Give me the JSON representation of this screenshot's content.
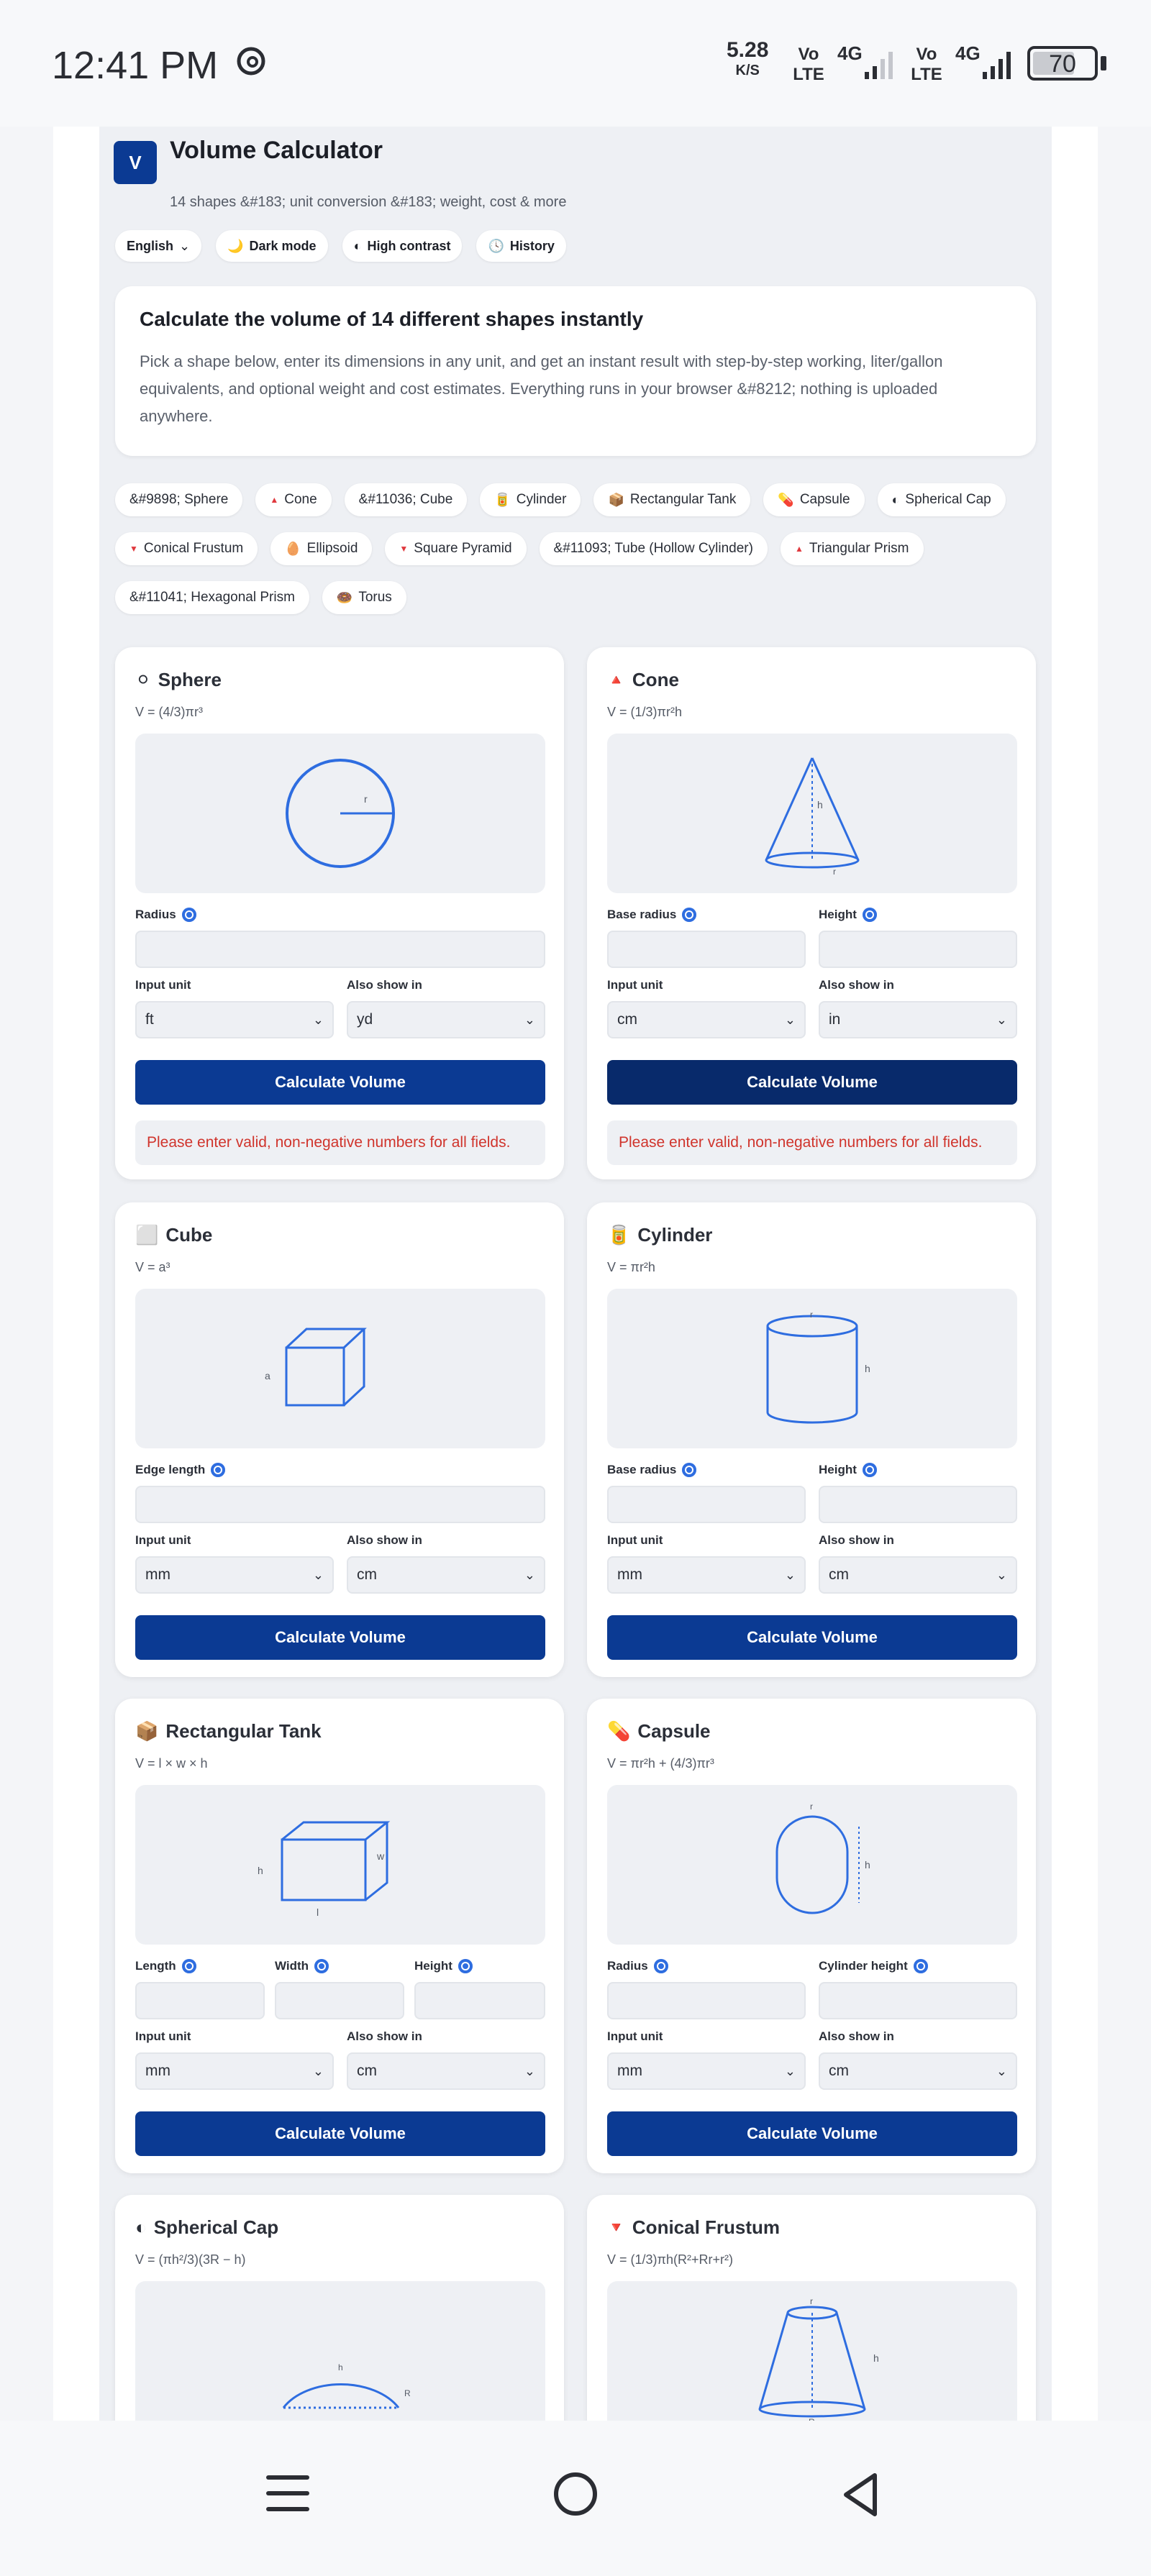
{
  "status_bar": {
    "time": "12:41 PM",
    "net_speed_value": "5.28",
    "net_speed_unit": "K/S",
    "sim1_label": "Vo LTE",
    "sim1_net": "4G",
    "sim2_label": "Vo LTE",
    "sim2_net": "4G",
    "battery": "70",
    "battery_level": 0.7,
    "threads_icon": "threads-icon"
  },
  "header": {
    "logo_letter": "V",
    "title": "Volume Calculator",
    "subtitle": "14 shapes &#183; unit conversion &#183; weight, cost & more",
    "chips": [
      {
        "icon": "",
        "label": "English",
        "has_caret": true
      },
      {
        "icon": "🌙",
        "label": "Dark mode"
      },
      {
        "icon": "◐",
        "label": "High contrast"
      },
      {
        "icon": "🕓",
        "label": "History"
      }
    ]
  },
  "intro": {
    "heading": "Calculate the volume of 14 different shapes instantly",
    "body": "Pick a shape below, enter its dimensions in any unit, and get an instant result with step-by-step working, liter/gallon equivalents, and optional weight and cost estimates. Everything runs in your browser &#8212; nothing is uploaded anywhere."
  },
  "shape_chips": [
    {
      "icon": "",
      "label": "&#9898; Sphere"
    },
    {
      "icon": "▲",
      "label": "Cone"
    },
    {
      "icon": "",
      "label": "&#11036; Cube"
    },
    {
      "icon": "🥫",
      "label": "Cylinder"
    },
    {
      "icon": "📦",
      "label": "Rectangular Tank"
    },
    {
      "icon": "💊",
      "label": "Capsule"
    },
    {
      "icon": "◐",
      "label": "Spherical Cap"
    },
    {
      "icon": "▼",
      "label": "Conical Frustum"
    },
    {
      "icon": "🥚",
      "label": "Ellipsoid"
    },
    {
      "icon": "▼",
      "label": "Square Pyramid"
    },
    {
      "icon": "",
      "label": "&#11093; Tube (Hollow Cylinder)"
    },
    {
      "icon": "▲",
      "label": "Triangular Prism"
    },
    {
      "icon": "",
      "label": "&#11041; Hexagonal Prism"
    },
    {
      "icon": "🍩",
      "label": "Torus"
    }
  ],
  "common": {
    "input_unit_label": "Input unit",
    "also_show_label": "Also show in",
    "calculate_label": "Calculate Volume",
    "error_text": "Please enter valid, non-negative numbers for all fields."
  },
  "cards": {
    "sphere": {
      "icon": "⚪",
      "title": "Sphere",
      "formula": "V = (4/3)πr³",
      "fields": [
        "Radius"
      ],
      "input_unit": "ft",
      "also_show": "yd",
      "diagram_labels": [
        "r"
      ]
    },
    "cone": {
      "icon": "🔺",
      "title": "Cone",
      "formula": "V = (1/3)πr²h",
      "fields": [
        "Base radius",
        "Height"
      ],
      "input_unit": "cm",
      "also_show": "in",
      "diagram_labels": [
        "h",
        "r"
      ]
    },
    "cube": {
      "icon": "⬜",
      "title": "Cube",
      "formula": "V = a³",
      "fields": [
        "Edge length"
      ],
      "input_unit": "mm",
      "also_show": "cm",
      "diagram_labels": [
        "a"
      ]
    },
    "cylinder": {
      "icon": "🥫",
      "title": "Cylinder",
      "formula": "V = πr²h",
      "fields": [
        "Base radius",
        "Height"
      ],
      "input_unit": "mm",
      "also_show": "cm",
      "diagram_labels": [
        "r",
        "h"
      ]
    },
    "tank": {
      "icon": "📦",
      "title": "Rectangular Tank",
      "formula": "V = l × w × h",
      "fields": [
        "Length",
        "Width",
        "Height"
      ],
      "input_unit": "mm",
      "also_show": "cm",
      "diagram_labels": [
        "h",
        "w",
        "l"
      ]
    },
    "capsule": {
      "icon": "💊",
      "title": "Capsule",
      "formula": "V = πr²h + (4/3)πr³",
      "fields": [
        "Radius",
        "Cylinder height"
      ],
      "input_unit": "mm",
      "also_show": "cm",
      "diagram_labels": [
        "r",
        "h"
      ]
    },
    "cap": {
      "icon": "◐",
      "title": "Spherical Cap",
      "formula": "V = (πh²/3)(3R − h)",
      "diagram_labels": [
        "h",
        "R"
      ]
    },
    "frustum": {
      "icon": "🔻",
      "title": "Conical Frustum",
      "formula": "V = (1/3)πh(R²+Rr+r²)",
      "diagram_labels": [
        "r",
        "h",
        "R"
      ]
    }
  }
}
